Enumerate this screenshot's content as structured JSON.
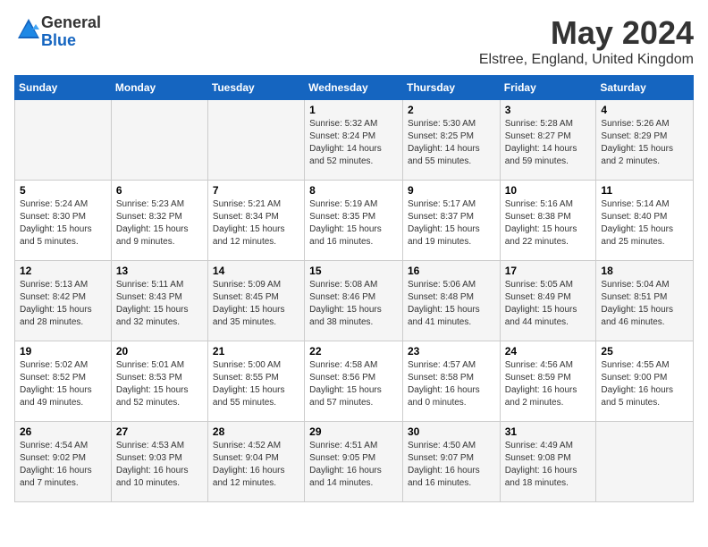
{
  "logo": {
    "general": "General",
    "blue": "Blue"
  },
  "title": {
    "month": "May 2024",
    "location": "Elstree, England, United Kingdom"
  },
  "header": {
    "days": [
      "Sunday",
      "Monday",
      "Tuesday",
      "Wednesday",
      "Thursday",
      "Friday",
      "Saturday"
    ]
  },
  "weeks": [
    {
      "cells": [
        {
          "date": "",
          "info": ""
        },
        {
          "date": "",
          "info": ""
        },
        {
          "date": "",
          "info": ""
        },
        {
          "date": "1",
          "info": "Sunrise: 5:32 AM\nSunset: 8:24 PM\nDaylight: 14 hours\nand 52 minutes."
        },
        {
          "date": "2",
          "info": "Sunrise: 5:30 AM\nSunset: 8:25 PM\nDaylight: 14 hours\nand 55 minutes."
        },
        {
          "date": "3",
          "info": "Sunrise: 5:28 AM\nSunset: 8:27 PM\nDaylight: 14 hours\nand 59 minutes."
        },
        {
          "date": "4",
          "info": "Sunrise: 5:26 AM\nSunset: 8:29 PM\nDaylight: 15 hours\nand 2 minutes."
        }
      ]
    },
    {
      "cells": [
        {
          "date": "5",
          "info": "Sunrise: 5:24 AM\nSunset: 8:30 PM\nDaylight: 15 hours\nand 5 minutes."
        },
        {
          "date": "6",
          "info": "Sunrise: 5:23 AM\nSunset: 8:32 PM\nDaylight: 15 hours\nand 9 minutes."
        },
        {
          "date": "7",
          "info": "Sunrise: 5:21 AM\nSunset: 8:34 PM\nDaylight: 15 hours\nand 12 minutes."
        },
        {
          "date": "8",
          "info": "Sunrise: 5:19 AM\nSunset: 8:35 PM\nDaylight: 15 hours\nand 16 minutes."
        },
        {
          "date": "9",
          "info": "Sunrise: 5:17 AM\nSunset: 8:37 PM\nDaylight: 15 hours\nand 19 minutes."
        },
        {
          "date": "10",
          "info": "Sunrise: 5:16 AM\nSunset: 8:38 PM\nDaylight: 15 hours\nand 22 minutes."
        },
        {
          "date": "11",
          "info": "Sunrise: 5:14 AM\nSunset: 8:40 PM\nDaylight: 15 hours\nand 25 minutes."
        }
      ]
    },
    {
      "cells": [
        {
          "date": "12",
          "info": "Sunrise: 5:13 AM\nSunset: 8:42 PM\nDaylight: 15 hours\nand 28 minutes."
        },
        {
          "date": "13",
          "info": "Sunrise: 5:11 AM\nSunset: 8:43 PM\nDaylight: 15 hours\nand 32 minutes."
        },
        {
          "date": "14",
          "info": "Sunrise: 5:09 AM\nSunset: 8:45 PM\nDaylight: 15 hours\nand 35 minutes."
        },
        {
          "date": "15",
          "info": "Sunrise: 5:08 AM\nSunset: 8:46 PM\nDaylight: 15 hours\nand 38 minutes."
        },
        {
          "date": "16",
          "info": "Sunrise: 5:06 AM\nSunset: 8:48 PM\nDaylight: 15 hours\nand 41 minutes."
        },
        {
          "date": "17",
          "info": "Sunrise: 5:05 AM\nSunset: 8:49 PM\nDaylight: 15 hours\nand 44 minutes."
        },
        {
          "date": "18",
          "info": "Sunrise: 5:04 AM\nSunset: 8:51 PM\nDaylight: 15 hours\nand 46 minutes."
        }
      ]
    },
    {
      "cells": [
        {
          "date": "19",
          "info": "Sunrise: 5:02 AM\nSunset: 8:52 PM\nDaylight: 15 hours\nand 49 minutes."
        },
        {
          "date": "20",
          "info": "Sunrise: 5:01 AM\nSunset: 8:53 PM\nDaylight: 15 hours\nand 52 minutes."
        },
        {
          "date": "21",
          "info": "Sunrise: 5:00 AM\nSunset: 8:55 PM\nDaylight: 15 hours\nand 55 minutes."
        },
        {
          "date": "22",
          "info": "Sunrise: 4:58 AM\nSunset: 8:56 PM\nDaylight: 15 hours\nand 57 minutes."
        },
        {
          "date": "23",
          "info": "Sunrise: 4:57 AM\nSunset: 8:58 PM\nDaylight: 16 hours\nand 0 minutes."
        },
        {
          "date": "24",
          "info": "Sunrise: 4:56 AM\nSunset: 8:59 PM\nDaylight: 16 hours\nand 2 minutes."
        },
        {
          "date": "25",
          "info": "Sunrise: 4:55 AM\nSunset: 9:00 PM\nDaylight: 16 hours\nand 5 minutes."
        }
      ]
    },
    {
      "cells": [
        {
          "date": "26",
          "info": "Sunrise: 4:54 AM\nSunset: 9:02 PM\nDaylight: 16 hours\nand 7 minutes."
        },
        {
          "date": "27",
          "info": "Sunrise: 4:53 AM\nSunset: 9:03 PM\nDaylight: 16 hours\nand 10 minutes."
        },
        {
          "date": "28",
          "info": "Sunrise: 4:52 AM\nSunset: 9:04 PM\nDaylight: 16 hours\nand 12 minutes."
        },
        {
          "date": "29",
          "info": "Sunrise: 4:51 AM\nSunset: 9:05 PM\nDaylight: 16 hours\nand 14 minutes."
        },
        {
          "date": "30",
          "info": "Sunrise: 4:50 AM\nSunset: 9:07 PM\nDaylight: 16 hours\nand 16 minutes."
        },
        {
          "date": "31",
          "info": "Sunrise: 4:49 AM\nSunset: 9:08 PM\nDaylight: 16 hours\nand 18 minutes."
        },
        {
          "date": "",
          "info": ""
        }
      ]
    }
  ]
}
